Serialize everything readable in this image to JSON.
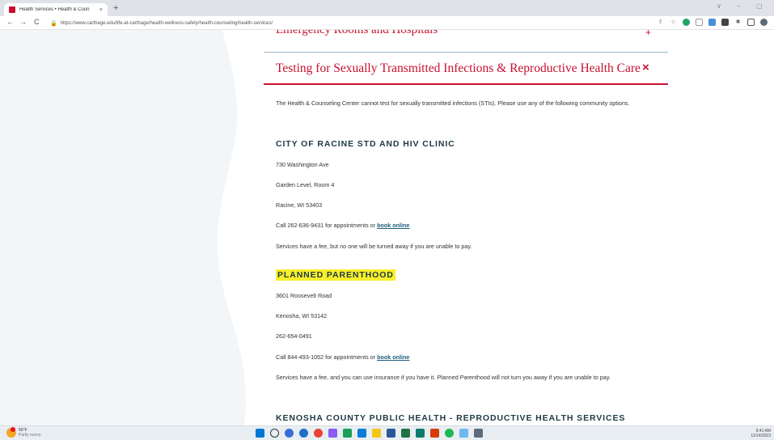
{
  "browser": {
    "tab_title": "Health Services • Health & Coun",
    "tab_close": "×",
    "new_tab": "+",
    "back": "←",
    "forward": "→",
    "reload": "C",
    "url": "https://www.carthage.edu/life-at-carthage/health-wellness-safety/health-counseling/health-services/",
    "window_controls": [
      "∨",
      "−",
      "▢"
    ]
  },
  "page": {
    "previous_section_title": "Emergency Rooms and Hospitals",
    "previous_section_toggle": "+",
    "section_title": "Testing for Sexually Transmitted Infections & Reproductive Health Care",
    "section_close": "×",
    "intro": "The Health & Counseling Center cannot test for sexually transmitted infections (STIs). Please use any of the following community options.",
    "clinic1": {
      "name": "CITY OF RACINE STD AND HIV CLINIC",
      "address1": "730 Washington Ave",
      "address2": "Garden Level, Room 4",
      "city": "Racine, WI 53403",
      "call_prefix": "Call 262-636-9431 for appointments or ",
      "link": "book online",
      "note": "Services have a fee, but no one will be turned away if you are unable to pay."
    },
    "clinic2": {
      "name": "PLANNED PARENTHOOD",
      "address1": "3601 Roosevelt Road",
      "city": "Kenosha, WI 53142",
      "phone": "262-654-0491",
      "call_prefix": "Call 844-493-1052 for appointments or ",
      "link": "book online",
      "note": "Services have a fee, and you can use insurance if you have it. Planned Parenthood will not turn you away if you are unable to pay."
    },
    "clinic3": {
      "name": "KENOSHA COUNTY PUBLIC HEALTH - REPRODUCTIVE HEALTH SERVICES"
    }
  },
  "taskbar": {
    "weather_temp": "56°F",
    "weather_desc": "Partly sunny",
    "time": "9:41 AM",
    "date": "11/14/2023"
  },
  "colors": {
    "brand_red": "#c8102e",
    "heading_navy": "#1d3a46",
    "highlight": "#f9ef2a",
    "side_bg": "#f3f6f8"
  }
}
